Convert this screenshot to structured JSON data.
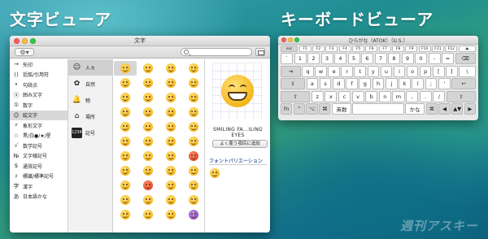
{
  "headlines": {
    "left": "文字ビューア",
    "right": "キーボードビューア"
  },
  "char_viewer": {
    "window_title": "文字",
    "gear_label": "⚙▾",
    "categories": [
      {
        "icon": "→",
        "label": "矢印",
        "icon_name": "arrow-icon"
      },
      {
        "icon": "()",
        "label": "括弧/引用符",
        "icon_name": "brackets-icon"
      },
      {
        "icon": "•",
        "label": "句読点",
        "icon_name": "punctuation-icon"
      },
      {
        "icon": "ⓐ",
        "label": "囲み文字",
        "icon_name": "circled-letter-icon"
      },
      {
        "icon": "①",
        "label": "数字",
        "icon_name": "digit-icon"
      },
      {
        "icon": "☺",
        "label": "絵文字",
        "icon_name": "emoji-icon"
      },
      {
        "icon": "⚡",
        "label": "象形文字",
        "icon_name": "pictograph-icon"
      },
      {
        "icon": "☆",
        "label": "黒/白●/★/星",
        "icon_name": "star-icon"
      },
      {
        "icon": "√",
        "label": "数学記号",
        "icon_name": "math-icon"
      },
      {
        "icon": "№",
        "label": "文字様記号",
        "icon_name": "letterlike-icon"
      },
      {
        "icon": "$",
        "label": "通貨記号",
        "icon_name": "currency-icon"
      },
      {
        "icon": "♯",
        "label": "標識/標準記号",
        "icon_name": "sign-icon"
      },
      {
        "icon": "字",
        "label": "漢字",
        "icon_name": "kanji-icon"
      },
      {
        "icon": "あ",
        "label": "日本語かな",
        "icon_name": "kana-icon"
      }
    ],
    "selected_category_index": 5,
    "subcategories": [
      {
        "icon": "☺",
        "label": "人々",
        "icon_name": "people-icon"
      },
      {
        "icon": "✿",
        "label": "自然",
        "icon_name": "nature-icon"
      },
      {
        "icon": "🔔",
        "label": "物",
        "icon_name": "objects-icon"
      },
      {
        "icon": "⌂",
        "label": "場所",
        "icon_name": "places-icon"
      },
      {
        "icon": "1234",
        "label": "記号",
        "icon_name": "symbols-icon"
      }
    ],
    "selected_subcategory_index": 0,
    "emoji_rows": 11,
    "emoji_cols": 4,
    "selected_character_name": "SMILING FA...ILING EYES",
    "add_favorite_label": "よく使う項目に追加",
    "font_variation_label": "フォントバリエーション"
  },
  "keyboard_viewer": {
    "window_title": "ひらがな（ATOK）（U.S.）",
    "rows": [
      [
        "esc",
        "F1",
        "F2",
        "F3",
        "F4",
        "F5",
        "F6",
        "F7",
        "F8",
        "F9",
        "F10",
        "F11",
        "F12",
        "⏏"
      ],
      [
        "`",
        "1",
        "2",
        "3",
        "4",
        "5",
        "6",
        "7",
        "8",
        "9",
        "0",
        "-",
        "=",
        "⌫"
      ],
      [
        "⇥",
        "q",
        "w",
        "e",
        "r",
        "t",
        "y",
        "u",
        "i",
        "o",
        "p",
        "[",
        "]",
        "\\"
      ],
      [
        "⇪",
        "a",
        "s",
        "d",
        "f",
        "g",
        "h",
        "j",
        "k",
        "l",
        ";",
        "'",
        "↩"
      ],
      [
        "⇧",
        "z",
        "x",
        "c",
        "v",
        "b",
        "n",
        "m",
        ",",
        ".",
        "/",
        "⇧"
      ],
      [
        "fn",
        "⌃",
        "⌥",
        "⌘",
        "英数",
        "",
        "かな",
        "⌘",
        "◀",
        "▲▼",
        "▶"
      ]
    ]
  },
  "watermark": "週刊アスキー"
}
